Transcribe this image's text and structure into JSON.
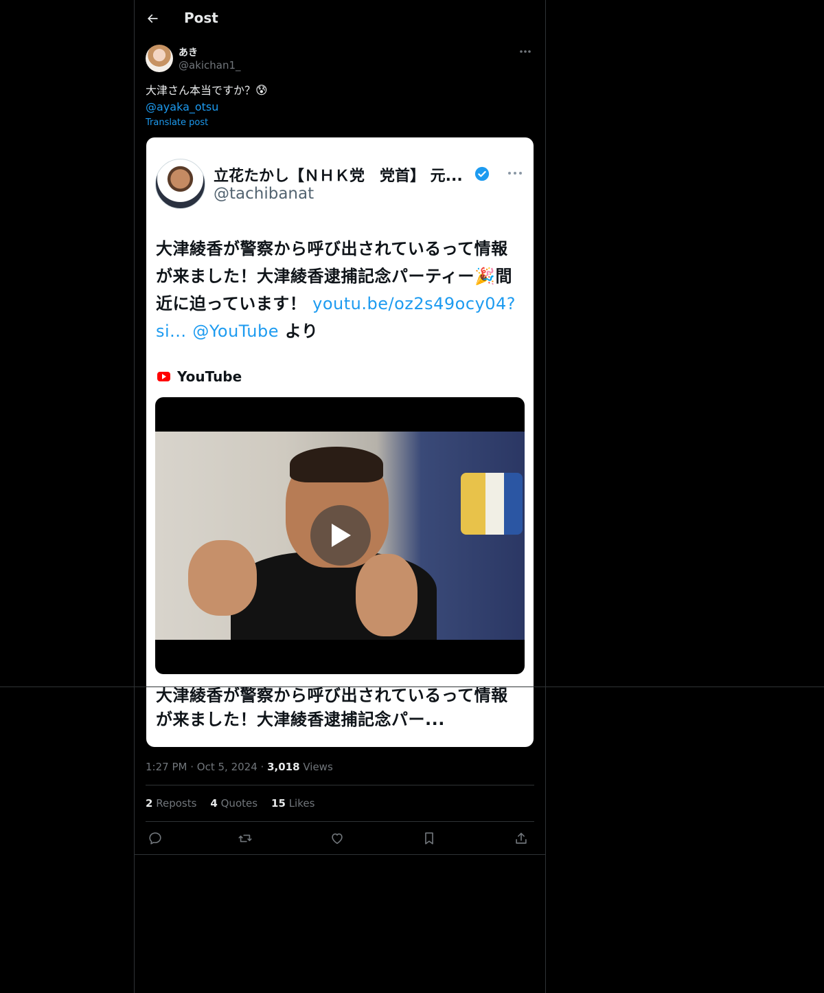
{
  "header": {
    "title": "Post",
    "back_icon": "arrow-left-icon"
  },
  "post": {
    "author": {
      "display_name": "あき",
      "handle": "@akichan1_"
    },
    "text": "大津さん本当ですか？",
    "emoji": "😰",
    "mention": "@ayaka_otsu",
    "translate_label": "Translate post",
    "time": "1:27 PM",
    "date": "Oct 5, 2024",
    "views_count": "3,018",
    "views_label": "Views",
    "separator": "·"
  },
  "embedded_card": {
    "author_name": "立花たかし【ＮＨＫ党　党首】 元...",
    "author_handle": "@tachibanat",
    "body_bold_1": "大津綾香が警察から呼び出されているって情報が来ました！大津綾香逮捕記念パーティー",
    "body_emoji": "🎉",
    "body_bold_2": "間近に迫っています！ ",
    "body_link_1": "youtu.be/oz2s49ocy04?si...",
    "body_space": " ",
    "body_link_2": "@YouTube",
    "body_tail": " より",
    "source_label": "YouTube",
    "caption": "大津綾香が警察から呼び出されているって情報が来ました！大津綾香逮捕記念パー..."
  },
  "stats": {
    "reposts_count": "2",
    "reposts_label": "Reposts",
    "quotes_count": "4",
    "quotes_label": "Quotes",
    "likes_count": "15",
    "likes_label": "Likes"
  },
  "actions": [
    "reply-icon",
    "repost-icon",
    "like-icon",
    "bookmark-icon",
    "share-icon"
  ],
  "colors": {
    "background": "#000000",
    "accent": "#1d9bf0",
    "text": "#e7e9ea",
    "muted": "#71767b",
    "border": "#2f3336"
  }
}
